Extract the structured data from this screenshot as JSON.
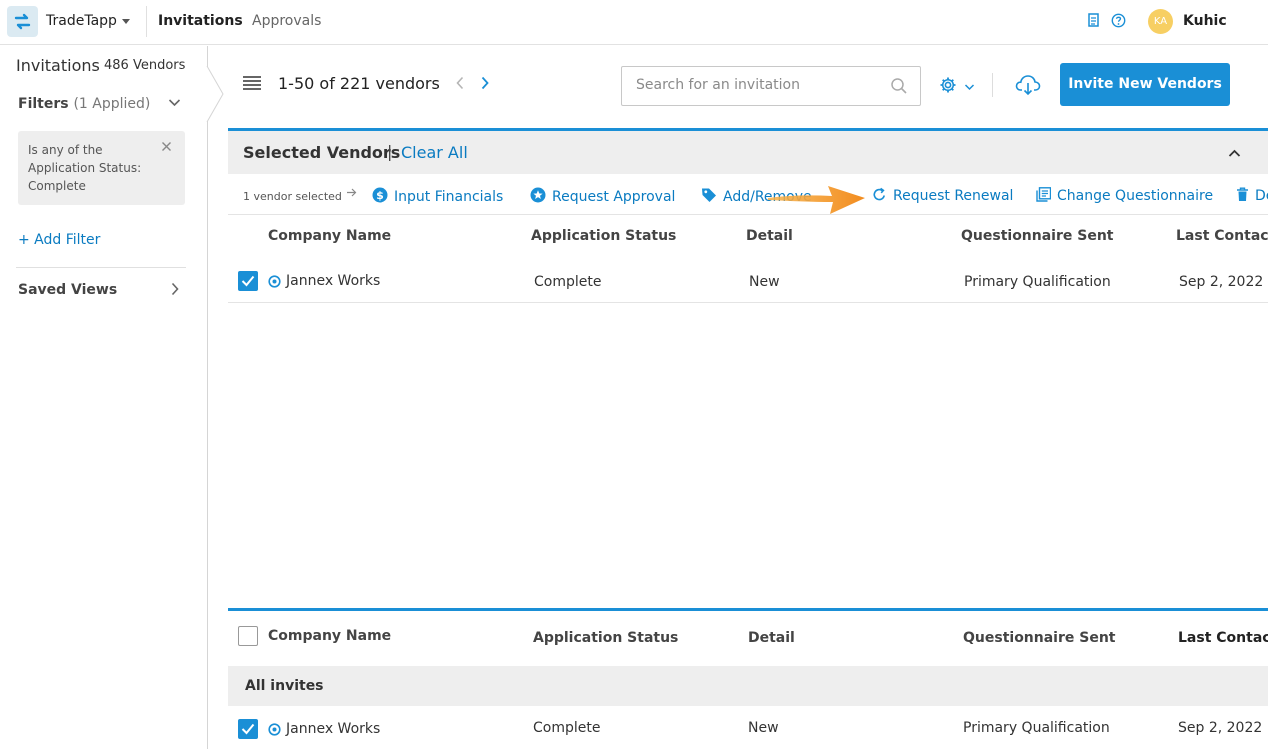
{
  "topnav": {
    "app_name": "TradeTapp",
    "tabs": [
      "Invitations",
      "Approvals"
    ],
    "user_initials": "KA",
    "user_name": "Kuhic"
  },
  "sidebar": {
    "title": "Invitations",
    "vendor_count": "486 Vendors",
    "filters_label": "Filters",
    "filters_applied": "(1 Applied)",
    "active_filter": "Is any of the Application Status: Complete",
    "add_filter": "+ Add Filter",
    "saved_views": "Saved Views"
  },
  "toolbar": {
    "range_text": "1-50 of 221 vendors",
    "search_placeholder": "Search for an invitation",
    "invite_button": "Invite New Vendors"
  },
  "selected_panel": {
    "title": "Selected Vendors",
    "separator": "|",
    "clear_all": "Clear All",
    "selected_count": "1 vendor selected",
    "actions": {
      "financials": "Input Financials",
      "approval": "Request Approval",
      "tags": "Add/Remove",
      "renewal": "Request Renewal",
      "questionnaire": "Change Questionnaire",
      "delete": "De"
    }
  },
  "table": {
    "columns": [
      "Company Name",
      "Application Status",
      "Detail",
      "Questionnaire Sent",
      "Last Contacted"
    ],
    "group_label": "All invites",
    "rows": [
      {
        "company": "Jannex Works",
        "status": "Complete",
        "detail": "New",
        "questionnaire": "Primary Qualification",
        "last_contacted": "Sep 2, 2022"
      }
    ]
  },
  "colors": {
    "accent": "#1a8fd6",
    "link": "#0a7bc1",
    "status_complete": "#7aa62d",
    "annotation_arrow": "#f28c1f"
  },
  "icons": [
    "tradetapp-logo-icon",
    "caret-down-icon",
    "document-icon",
    "help-icon",
    "chevron-down-icon",
    "chevron-right-icon",
    "close-icon",
    "hamburger-menu-icon",
    "chevron-left-icon",
    "search-icon",
    "gear-icon",
    "cloud-download-icon",
    "chevron-up-icon",
    "arrow-right-icon",
    "dollar-icon",
    "star-badge-icon",
    "tag-icon",
    "refresh-icon",
    "questionnaire-icon",
    "trash-icon",
    "check-icon",
    "company-icon"
  ]
}
